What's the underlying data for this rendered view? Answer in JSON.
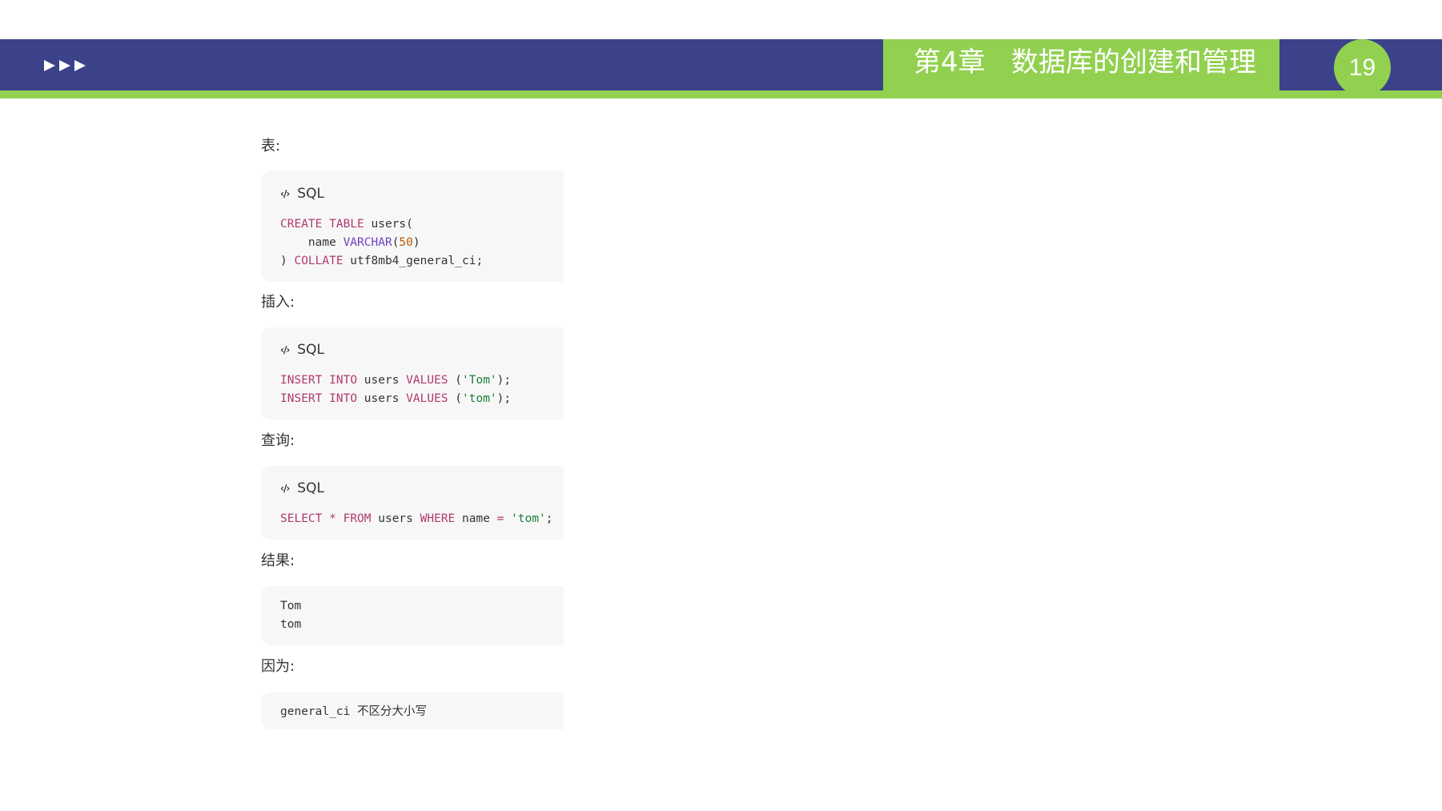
{
  "header": {
    "chapter_title": "第4章   数据库的创建和管理",
    "page_number": "19",
    "colors": {
      "band": "#3c4289",
      "accent": "#92d050"
    }
  },
  "sections": [
    {
      "label": "表:",
      "code_lang": "SQL",
      "lines": [
        [
          "CREATE",
          " ",
          "TABLE",
          " users("
        ],
        [
          "    name ",
          "VARCHAR",
          "(",
          "50",
          ")"
        ],
        [
          ") ",
          "COLLATE",
          " utf8mb4_general_ci;"
        ]
      ]
    },
    {
      "label": "插入:",
      "code_lang": "SQL",
      "lines": [
        [
          "INSERT",
          " ",
          "INTO",
          " users ",
          "VALUES",
          " (",
          "'Tom'",
          ");"
        ],
        [
          "INSERT",
          " ",
          "INTO",
          " users ",
          "VALUES",
          " (",
          "'tom'",
          ");"
        ]
      ]
    },
    {
      "label": "查询:",
      "code_lang": "SQL",
      "lines": [
        [
          "SELECT",
          " ",
          "*",
          " ",
          "FROM",
          " users ",
          "WHERE",
          " name ",
          "=",
          " ",
          "'tom'",
          ";"
        ]
      ]
    },
    {
      "label": "结果:",
      "lines": [
        [
          "Tom"
        ],
        [
          "tom"
        ]
      ]
    },
    {
      "label": "因为:",
      "lines": [
        [
          "general_ci 不区分大小写"
        ]
      ]
    }
  ]
}
